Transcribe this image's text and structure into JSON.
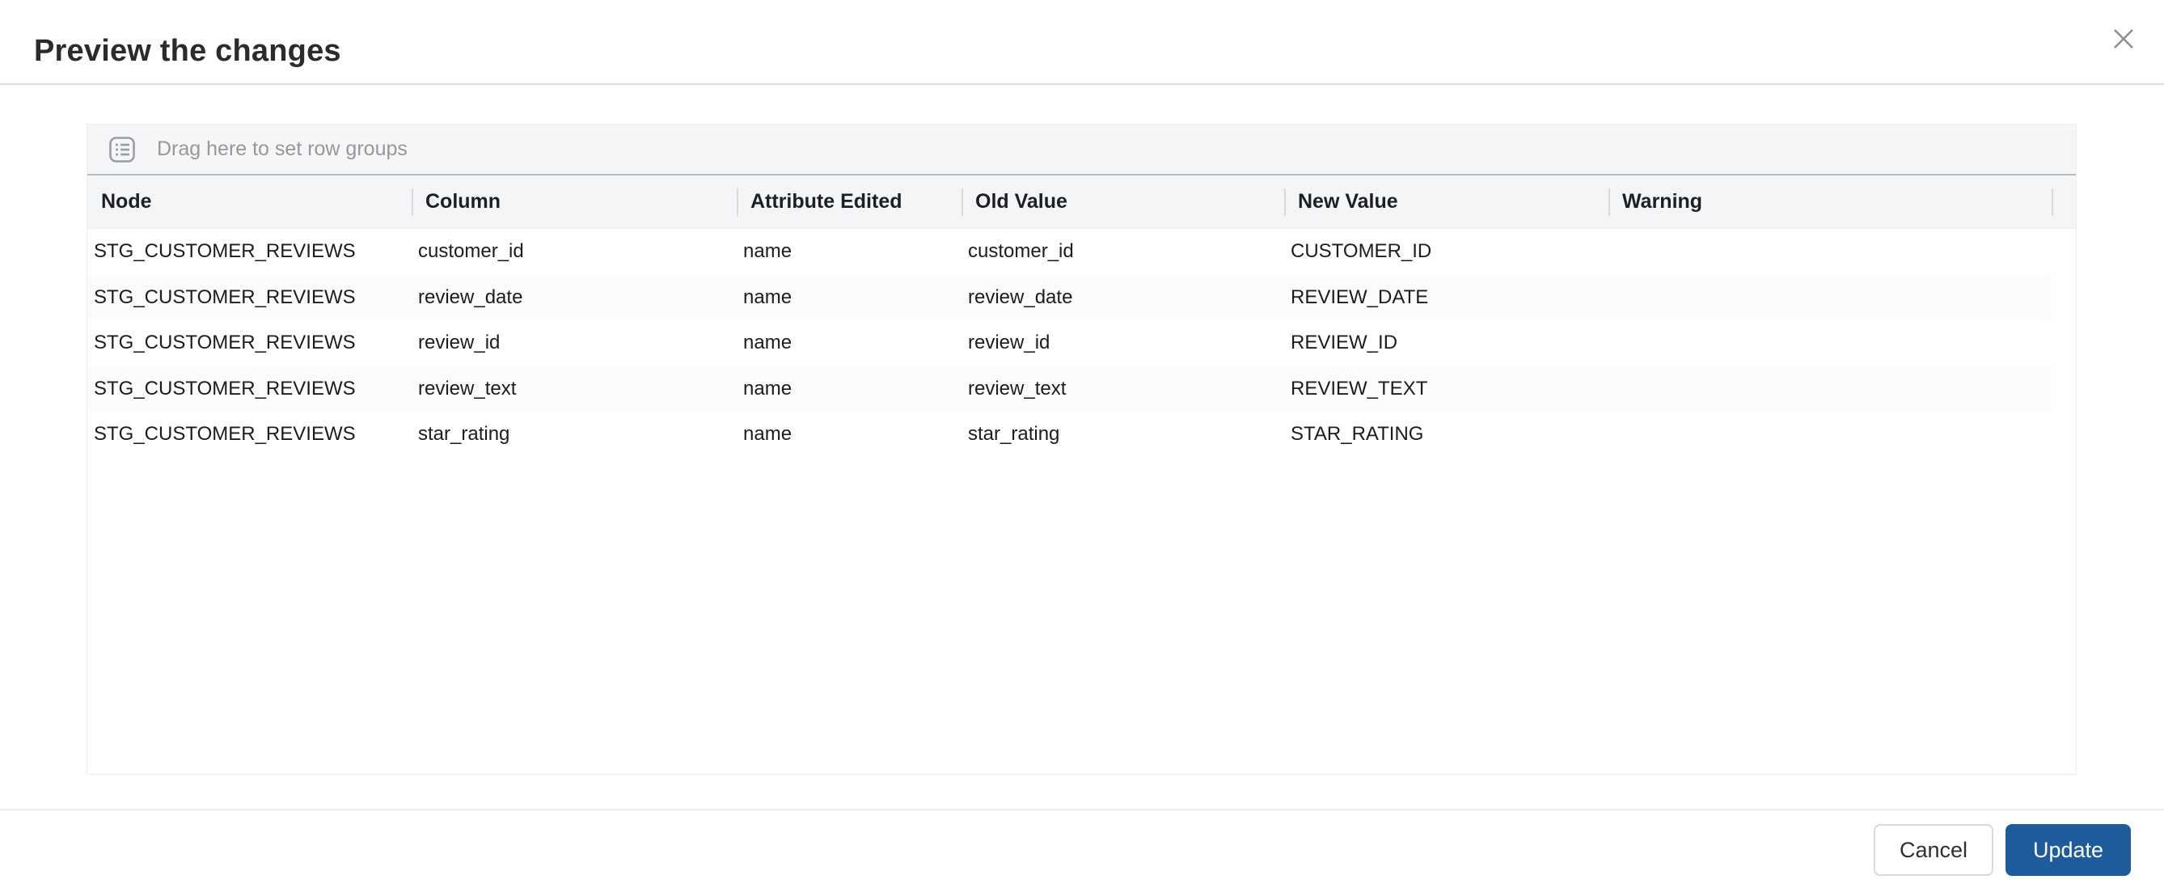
{
  "dialog": {
    "title": "Preview the changes"
  },
  "grid": {
    "group_panel_text": "Drag here to set row groups",
    "columns": [
      {
        "key": "node",
        "label": "Node"
      },
      {
        "key": "column",
        "label": "Column"
      },
      {
        "key": "attribute_edited",
        "label": "Attribute Edited"
      },
      {
        "key": "old_value",
        "label": "Old Value"
      },
      {
        "key": "new_value",
        "label": "New Value"
      },
      {
        "key": "warning",
        "label": "Warning"
      }
    ],
    "rows": [
      {
        "node": "STG_CUSTOMER_REVIEWS",
        "column": "customer_id",
        "attribute_edited": "name",
        "old_value": "customer_id",
        "new_value": "CUSTOMER_ID",
        "warning": ""
      },
      {
        "node": "STG_CUSTOMER_REVIEWS",
        "column": "review_date",
        "attribute_edited": "name",
        "old_value": "review_date",
        "new_value": "REVIEW_DATE",
        "warning": ""
      },
      {
        "node": "STG_CUSTOMER_REVIEWS",
        "column": "review_id",
        "attribute_edited": "name",
        "old_value": "review_id",
        "new_value": "REVIEW_ID",
        "warning": ""
      },
      {
        "node": "STG_CUSTOMER_REVIEWS",
        "column": "review_text",
        "attribute_edited": "name",
        "old_value": "review_text",
        "new_value": "REVIEW_TEXT",
        "warning": ""
      },
      {
        "node": "STG_CUSTOMER_REVIEWS",
        "column": "star_rating",
        "attribute_edited": "name",
        "old_value": "star_rating",
        "new_value": "STAR_RATING",
        "warning": ""
      }
    ]
  },
  "footer": {
    "cancel_label": "Cancel",
    "update_label": "Update"
  },
  "icons": {
    "close": "close-icon",
    "row_groups": "row-groups-icon"
  },
  "colors": {
    "accent_blue": "#1d5b9c",
    "header_bg": "#f4f5f7",
    "group_panel_bg": "#f5f6f7",
    "group_panel_border": "#b8bcc3",
    "row_stripe": "#fafbfd",
    "divider": "#dadada",
    "grid_border": "#eeeef0",
    "muted_text": "#96989b"
  }
}
